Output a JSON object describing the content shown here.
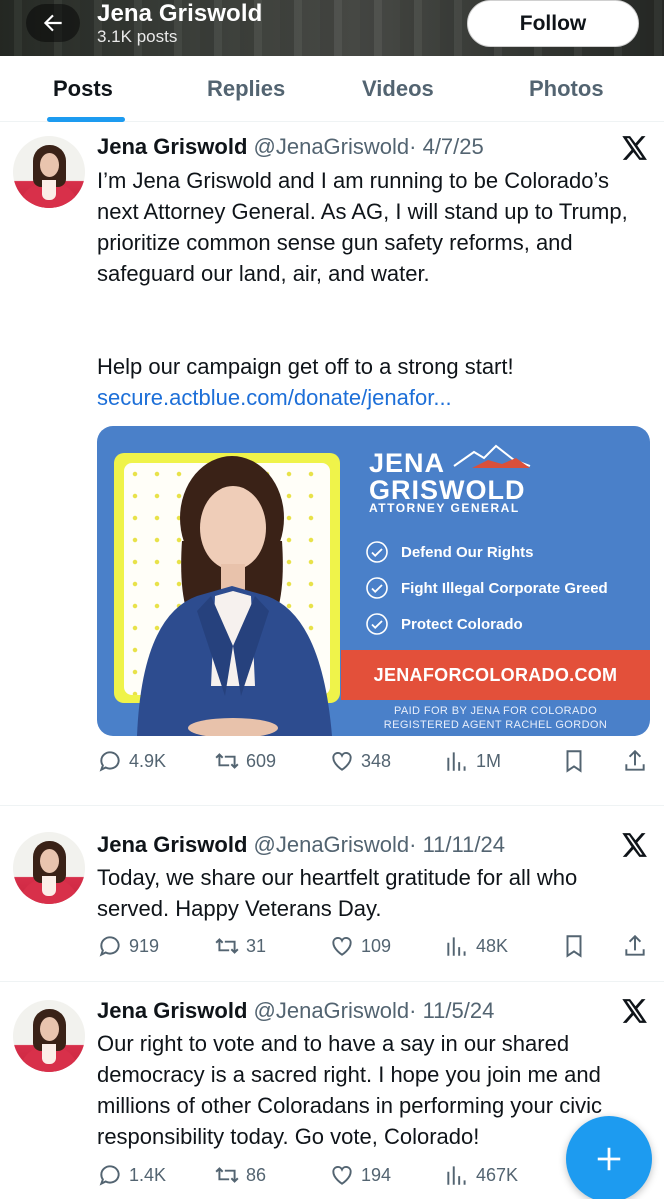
{
  "header": {
    "name": "Jena Griswold",
    "posts_count": "3.1K posts",
    "follow_label": "Follow",
    "back_icon": "arrow-left-icon"
  },
  "tabs": [
    {
      "label": "Posts",
      "active": true
    },
    {
      "label": "Replies",
      "active": false
    },
    {
      "label": "Videos",
      "active": false
    },
    {
      "label": "Photos",
      "active": false
    }
  ],
  "posts": [
    {
      "name": "Jena Griswold",
      "handle": "@JenaGriswold",
      "date": "· 4/7/25",
      "text": "I’m Jena Griswold and I am running to be Colorado’s next Attorney General.  As AG, I will stand up to Trump, prioritize common sense gun safety reforms, and safeguard our land, air, and water.",
      "text2": "Help our campaign get off to a strong start!",
      "link": "secure.actblue.com/donate/jenafor...",
      "media": {
        "first_name": "JENA",
        "last_name": "GRISWOLD",
        "title": "ATTORNEY GENERAL",
        "checks": [
          "Defend Our Rights",
          "Fight Illegal Corporate Greed",
          "Protect Colorado"
        ],
        "site": "JENAFORCOLORADO.COM",
        "paid_line1": "PAID FOR BY JENA FOR COLORADO",
        "paid_line2": "REGISTERED AGENT RACHEL GORDON"
      },
      "stats": {
        "replies": "4.9K",
        "reposts": "609",
        "likes": "348",
        "views": "1M"
      }
    },
    {
      "name": "Jena Griswold",
      "handle": "@JenaGriswold",
      "date": "· 11/11/24",
      "text": "Today, we share our heartfelt gratitude for all who served. Happy Veterans Day.",
      "stats": {
        "replies": "919",
        "reposts": "31",
        "likes": "109",
        "views": "48K"
      }
    },
    {
      "name": "Jena Griswold",
      "handle": "@JenaGriswold",
      "date": "· 11/5/24",
      "text": "Our right to vote and to have a say in our shared democracy is a sacred right. I hope you join me and millions of other Coloradans in performing your civic responsibility today. Go vote, Colorado!",
      "stats": {
        "replies": "1.4K",
        "reposts": "86",
        "likes": "194",
        "views": "467K"
      }
    }
  ],
  "colors": {
    "accent": "#1d9bf0",
    "link": "#1d6fd8",
    "muted": "#536471",
    "banner_blue": "#4a80c9",
    "banner_red": "#e3503a"
  },
  "fab_icon": "plus-icon"
}
